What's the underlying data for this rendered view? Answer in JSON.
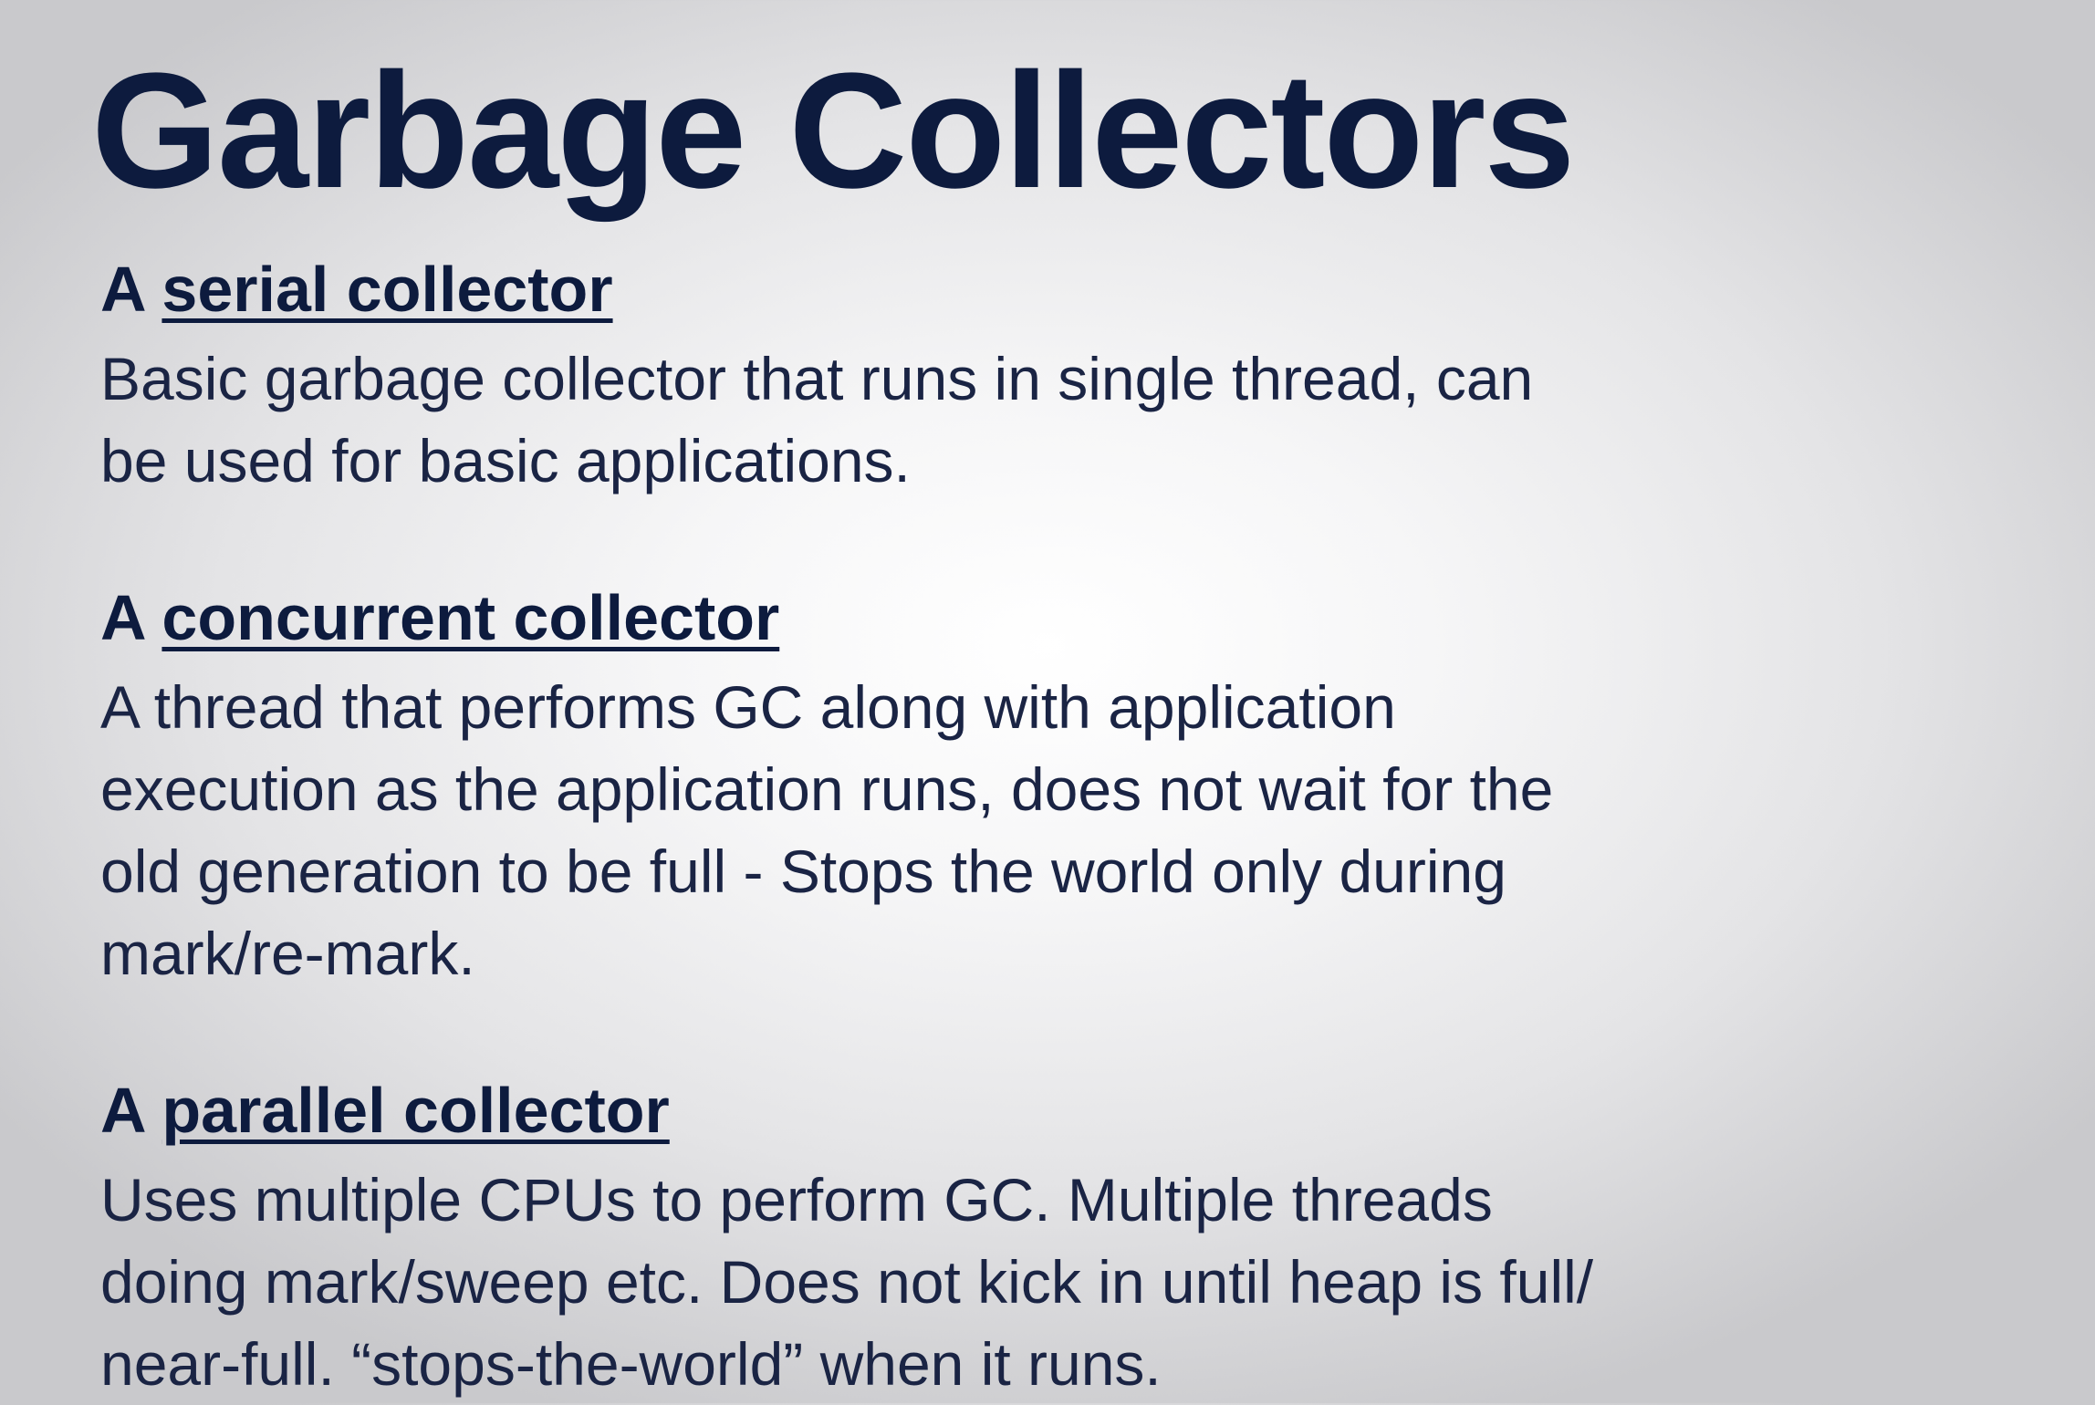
{
  "slide": {
    "title": "Garbage Collectors",
    "sections": [
      {
        "article": "A",
        "term": "serial collector",
        "lines": [
          "Basic garbage collector that runs in single thread, can",
          "be used for basic applications."
        ]
      },
      {
        "article": "A",
        "term": "concurrent collector",
        "lines": [
          "A thread that performs GC along with application",
          "execution as the application runs, does not wait for the",
          "old generation to be full - Stops the world only during",
          "mark/re-mark."
        ]
      },
      {
        "article": "A",
        "term": "parallel collector",
        "lines": [
          "Uses multiple CPUs to perform GC. Multiple threads",
          "doing mark/sweep etc. Does not kick in until heap is full/",
          "near-full. “stops-the-world” when it runs."
        ]
      }
    ]
  },
  "colors": {
    "heading": "#0d1b3e",
    "body": "#1a2444",
    "background_center": "#ffffff",
    "background_edge": "#c9c9cc"
  }
}
